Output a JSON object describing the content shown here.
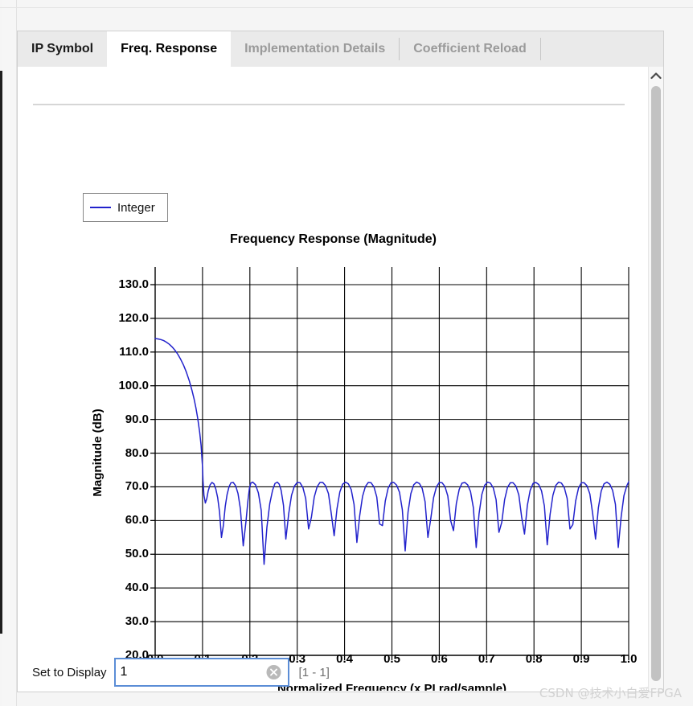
{
  "window": {
    "watermark": "CSDN @技术小白爱FPGA"
  },
  "tabs": [
    {
      "label": "IP Symbol",
      "state": "inactive"
    },
    {
      "label": "Freq. Response",
      "state": "active"
    },
    {
      "label": "Implementation Details",
      "state": "disabled"
    },
    {
      "label": "Coefficient Reload",
      "state": "disabled"
    }
  ],
  "legend": {
    "entries": [
      {
        "label": "Integer",
        "color": "#2222cc"
      }
    ]
  },
  "scrollbar": {
    "up_arrow_icon": "chevron-up-icon"
  },
  "footer": {
    "set_to_display_label": "Set to Display",
    "input_value": "1",
    "input_placeholder": "",
    "clear_icon": "clear-circle-icon",
    "range_hint": "[1 - 1]"
  },
  "chart_data": {
    "type": "line",
    "title": "Frequency Response (Magnitude)",
    "xlabel": "Normalized Frequency (x PI rad/sample)",
    "ylabel": "Magnitude (dB)",
    "xlim": [
      0.0,
      1.0
    ],
    "ylim": [
      20.0,
      130.0
    ],
    "xticks": [
      "0.0",
      "0.1",
      "0.2",
      "0.3",
      "0.4",
      "0.5",
      "0.6",
      "0.7",
      "0.8",
      "0.9",
      "1.0"
    ],
    "xtick_values": [
      0.0,
      0.1,
      0.2,
      0.3,
      0.4,
      0.5,
      0.6,
      0.7,
      0.8,
      0.9,
      1.0
    ],
    "yticks": [
      "20.0",
      "30.0",
      "40.0",
      "50.0",
      "60.0",
      "70.0",
      "80.0",
      "90.0",
      "100.0",
      "110.0",
      "120.0",
      "130.0"
    ],
    "ytick_values": [
      20,
      30,
      40,
      50,
      60,
      70,
      80,
      90,
      100,
      110,
      120,
      130
    ],
    "grid": true,
    "grid_color": "#000000",
    "legend_position": "top-left-outside",
    "series": [
      {
        "name": "Integer",
        "color": "#2222cc",
        "x": [
          0.0,
          0.006,
          0.012,
          0.018,
          0.024,
          0.03,
          0.036,
          0.042,
          0.048,
          0.054,
          0.06,
          0.066,
          0.072,
          0.078,
          0.082,
          0.086,
          0.09,
          0.094,
          0.097,
          0.1,
          0.101,
          0.103,
          0.106,
          0.109,
          0.112,
          0.116,
          0.12,
          0.124,
          0.128,
          0.132,
          0.136,
          0.14,
          0.144,
          0.148,
          0.152,
          0.156,
          0.16,
          0.165,
          0.17,
          0.175,
          0.18,
          0.186,
          0.192,
          0.196,
          0.199,
          0.202,
          0.206,
          0.212,
          0.218,
          0.224,
          0.23,
          0.236,
          0.242,
          0.248,
          0.253,
          0.258,
          0.262,
          0.266,
          0.271,
          0.276,
          0.282,
          0.288,
          0.294,
          0.3,
          0.306,
          0.312,
          0.318,
          0.324,
          0.33,
          0.336,
          0.342,
          0.348,
          0.354,
          0.36,
          0.366,
          0.372,
          0.378,
          0.384,
          0.39,
          0.396,
          0.402,
          0.408,
          0.414,
          0.42,
          0.426,
          0.432,
          0.438,
          0.444,
          0.45,
          0.456,
          0.462,
          0.468,
          0.474,
          0.48,
          0.486,
          0.492,
          0.498,
          0.504,
          0.51,
          0.516,
          0.522,
          0.528,
          0.534,
          0.54,
          0.546,
          0.552,
          0.558,
          0.564,
          0.57,
          0.576,
          0.582,
          0.588,
          0.594,
          0.6,
          0.606,
          0.612,
          0.618,
          0.624,
          0.63,
          0.636,
          0.642,
          0.648,
          0.654,
          0.66,
          0.666,
          0.672,
          0.678,
          0.684,
          0.69,
          0.696,
          0.702,
          0.708,
          0.714,
          0.72,
          0.726,
          0.732,
          0.738,
          0.744,
          0.75,
          0.756,
          0.762,
          0.768,
          0.774,
          0.78,
          0.786,
          0.792,
          0.798,
          0.804,
          0.81,
          0.816,
          0.822,
          0.828,
          0.834,
          0.84,
          0.846,
          0.852,
          0.858,
          0.864,
          0.87,
          0.876,
          0.882,
          0.888,
          0.894,
          0.9,
          0.906,
          0.912,
          0.918,
          0.924,
          0.93,
          0.936,
          0.942,
          0.948,
          0.954,
          0.96,
          0.966,
          0.972,
          0.978,
          0.984,
          0.99,
          0.996,
          1.0
        ],
        "y": [
          114.0,
          113.9,
          113.7,
          113.4,
          112.9,
          112.3,
          111.5,
          110.5,
          109.3,
          107.8,
          106.1,
          104.0,
          101.5,
          98.5,
          96.2,
          93.5,
          90.2,
          86.2,
          82.3,
          76.0,
          72.0,
          67.5,
          65.2,
          66.5,
          68.8,
          70.6,
          71.3,
          70.9,
          69.4,
          66.8,
          62.5,
          55.0,
          58.5,
          64.2,
          67.8,
          70.0,
          71.2,
          71.3,
          70.3,
          68.0,
          63.5,
          52.5,
          60.0,
          66.0,
          69.5,
          71.1,
          71.4,
          70.6,
          68.2,
          63.0,
          47.0,
          58.0,
          65.0,
          69.0,
          71.0,
          71.4,
          70.8,
          69.0,
          64.5,
          54.5,
          62.0,
          67.5,
          70.2,
          71.3,
          71.2,
          69.8,
          66.5,
          57.5,
          61.0,
          67.0,
          70.0,
          71.3,
          71.3,
          70.3,
          68.0,
          62.0,
          55.5,
          63.5,
          68.5,
          70.8,
          71.4,
          70.9,
          69.2,
          64.8,
          53.5,
          61.5,
          67.2,
          70.1,
          71.3,
          71.2,
          70.0,
          67.0,
          59.0,
          58.5,
          65.8,
          69.6,
          71.2,
          71.3,
          70.5,
          68.4,
          63.2,
          51.0,
          62.5,
          68.0,
          70.6,
          71.4,
          71.0,
          69.5,
          65.6,
          55.0,
          60.5,
          66.8,
          70.0,
          71.3,
          71.2,
          70.1,
          67.3,
          60.0,
          57.0,
          65.0,
          69.2,
          71.1,
          71.3,
          70.6,
          68.6,
          63.8,
          52.0,
          62.0,
          67.8,
          70.5,
          71.4,
          71.1,
          69.7,
          66.2,
          56.5,
          59.5,
          66.2,
          69.8,
          71.2,
          71.2,
          70.2,
          67.6,
          61.0,
          56.0,
          64.5,
          69.0,
          71.0,
          71.3,
          70.7,
          68.8,
          64.3,
          52.8,
          61.8,
          67.5,
          70.4,
          71.4,
          71.1,
          69.8,
          66.6,
          57.5,
          58.8,
          65.8,
          69.6,
          71.2,
          71.2,
          70.3,
          67.9,
          62.0,
          54.5,
          63.8,
          68.8,
          70.9,
          71.4,
          70.8,
          69.0,
          64.8,
          52.0,
          61.0,
          67.4,
          70.3,
          71.5,
          71.8
        ]
      }
    ]
  }
}
